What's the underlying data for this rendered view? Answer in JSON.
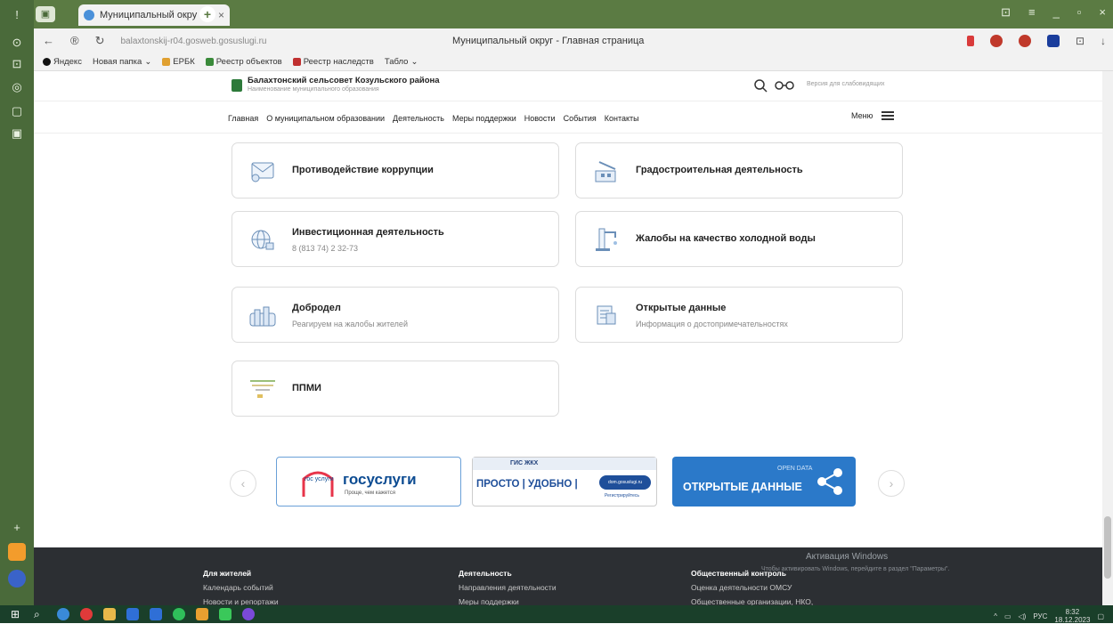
{
  "browser": {
    "tab_title": "Муниципальный окру",
    "url": "balaxtonskij-r04.gosweb.gosuslugi.ru",
    "page_title": "Муниципальный округ - Главная страница",
    "bookmarks": [
      "Яндекс",
      "Новая папка",
      "ЕРБК",
      "Реестр объектов",
      "Реестр наследств",
      "Табло"
    ]
  },
  "site": {
    "org_name": "Балахтонский сельсовет Козульского района",
    "org_sub": "Наименование муниципального образования",
    "vision_label": "Версия для слабовидящих",
    "nav": [
      "Главная",
      "О муниципальном образовании",
      "Деятельность",
      "Меры поддержки",
      "Новости",
      "События",
      "Контакты"
    ],
    "menu_label": "Меню"
  },
  "cards": [
    {
      "title": "Противодействие коррупции",
      "sub": "",
      "icon": "envelope-icon"
    },
    {
      "title": "Градостроительная деятельность",
      "sub": "",
      "icon": "construction-icon"
    },
    {
      "title": "Инвестиционная деятельность",
      "sub": "8 (813 74) 2 32-73",
      "icon": "globe-icon"
    },
    {
      "title": "Жалобы на качество холодной воды",
      "sub": "",
      "icon": "faucet-icon"
    },
    {
      "title": "Добродел",
      "sub": "Реагируем на жалобы жителей",
      "icon": "city-icon"
    },
    {
      "title": "Открытые данные",
      "sub": "Информация о достопримечательностях",
      "icon": "data-icon"
    },
    {
      "title": "ППМИ",
      "sub": "",
      "icon": "ppmi-icon"
    }
  ],
  "banners": {
    "gos_small": "гос услуги",
    "gos_big": "госуслуги",
    "gos_tag": "Проще, чем кажется",
    "gkh_tag": "ГИС ЖКХ",
    "gkh_main": "ПРОСТО | УДОБНО |",
    "gkh_site": "dom.gosuslugi.ru",
    "gkh_btn": "Регистрируйтесь",
    "od_small": "OPEN DATA",
    "od_main": "ОТКРЫТЫЕ ДАННЫЕ"
  },
  "footer": {
    "col1_head": "Для жителей",
    "col1_items": [
      "Календарь событий",
      "Новости и репортажи"
    ],
    "col2_head": "Деятельность",
    "col2_items": [
      "Направления деятельности",
      "Меры поддержки"
    ],
    "col3_head": "Общественный контроль",
    "col3_items": [
      "Оценка деятельности ОМСУ",
      "Общественные организации, НКО,"
    ],
    "win_title": "Активация Windows",
    "win_sub": "Чтобы активировать Windows, перейдите в раздел \"Параметры\"."
  },
  "taskbar": {
    "lang": "РУС",
    "time": "8:32",
    "date": "18.12.2023"
  },
  "colors": {
    "browser_green": "#5b7b43",
    "open_data_blue": "#2b79c9",
    "footer_dark": "#2c2f33"
  }
}
